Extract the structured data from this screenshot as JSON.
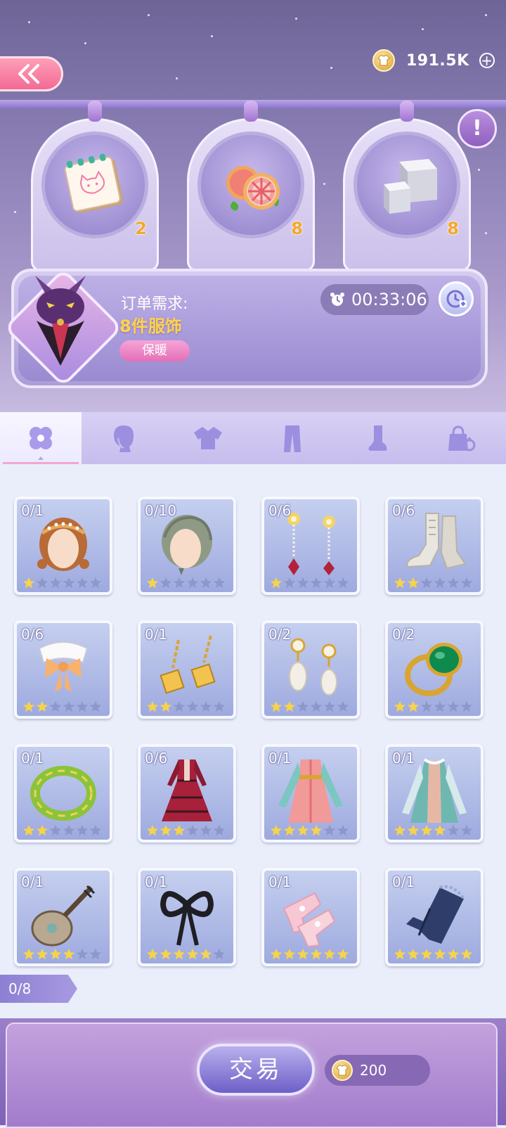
{
  "header": {
    "back_icon": "double-chevron-left-icon",
    "currency": {
      "icon": "shirt-coin-icon",
      "value": "191.5K",
      "add_icon": "plus-circle-icon"
    },
    "info_icon": "exclamation-icon"
  },
  "materials": [
    {
      "name": "sketch-notepad",
      "count": "2"
    },
    {
      "name": "grapefruit",
      "count": "8"
    },
    {
      "name": "crystal-cube",
      "count": "8"
    }
  ],
  "order": {
    "label": "订单需求:",
    "value": "8件服饰",
    "tag": "保暖",
    "timer": "00:33:06",
    "timer_icon": "alarm-clock-icon",
    "add_time_icon": "clock-plus-icon"
  },
  "tabs": [
    {
      "name": "clover",
      "active": true
    },
    {
      "name": "hair",
      "active": false
    },
    {
      "name": "top",
      "active": false
    },
    {
      "name": "bottom",
      "active": false
    },
    {
      "name": "shoes",
      "active": false
    },
    {
      "name": "accessory",
      "active": false
    }
  ],
  "items": [
    {
      "name": "brown-hair-headband",
      "count": "0/1",
      "stars": 1
    },
    {
      "name": "grey-braided-hair",
      "count": "0/10",
      "stars": 1
    },
    {
      "name": "flower-ruby-earrings",
      "count": "0/6",
      "stars": 1
    },
    {
      "name": "white-lace-boots",
      "count": "0/6",
      "stars": 2
    },
    {
      "name": "bow-collar",
      "count": "0/6",
      "stars": 2
    },
    {
      "name": "gold-chain-earrings",
      "count": "0/1",
      "stars": 2
    },
    {
      "name": "pearl-drop-earrings",
      "count": "0/2",
      "stars": 2
    },
    {
      "name": "emerald-ring",
      "count": "0/2",
      "stars": 2
    },
    {
      "name": "jade-bangle",
      "count": "0/1",
      "stars": 2
    },
    {
      "name": "red-victorian-dress",
      "count": "0/6",
      "stars": 3
    },
    {
      "name": "pink-hanfu-dress",
      "count": "0/1",
      "stars": 4
    },
    {
      "name": "teal-robe-dress",
      "count": "0/1",
      "stars": 4
    },
    {
      "name": "pipa-instrument",
      "count": "0/1",
      "stars": 4
    },
    {
      "name": "black-ribbon-bow",
      "count": "0/1",
      "stars": 5
    },
    {
      "name": "pink-floral-socks",
      "count": "0/1",
      "stars": 6
    },
    {
      "name": "navy-lace-gloves",
      "count": "0/1",
      "stars": 6
    }
  ],
  "progress": "0/8",
  "trade": {
    "label": "交易",
    "cost": "200"
  },
  "colors": {
    "accent": "#f36a94",
    "gold": "#f4a82a",
    "order_value": "#ffd447",
    "star_on": "#f7d34a",
    "star_off": "#8d97c9"
  }
}
